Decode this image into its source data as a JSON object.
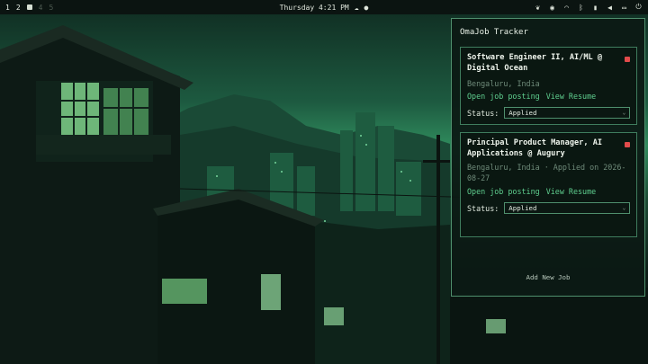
{
  "topbar": {
    "workspaces": [
      "1",
      "2",
      "4",
      "5"
    ],
    "clock": "Thursday 4:21 PM",
    "tray_icons": [
      "leaf-icon",
      "cloud-icon",
      "ghost-icon",
      "wifi-icon",
      "bluetooth-icon",
      "battery-icon",
      "volume-icon",
      "monitor-icon",
      "power-icon"
    ]
  },
  "panel": {
    "title": "OmaJob Tracker",
    "status_label": "Status:",
    "add_label": "Add New Job",
    "jobs": [
      {
        "title": "Software Engineer II, AI/ML @ Digital Ocean",
        "meta": "Bengaluru, India",
        "link_posting": "Open job posting",
        "link_resume": "View Resume",
        "status": "Applied"
      },
      {
        "title": "Principal Product Manager, AI Applications @ Augury",
        "meta": "Bengaluru, India · Applied on 2026-08-27",
        "link_posting": "Open job posting",
        "link_resume": "View Resume",
        "status": "Applied"
      }
    ]
  },
  "colors": {
    "accent": "#5fcf8f",
    "border": "#4f8f6d",
    "delete": "#e24b4b"
  }
}
